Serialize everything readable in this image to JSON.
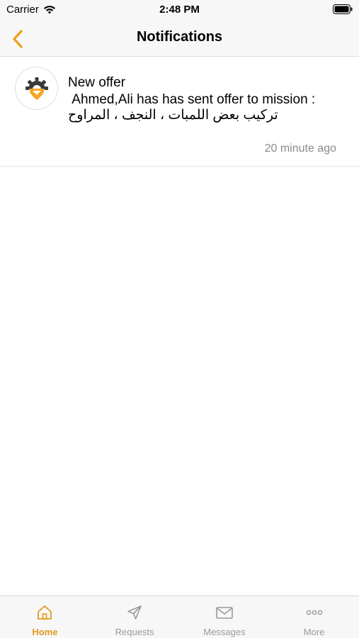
{
  "status_bar": {
    "carrier": "Carrier",
    "time": "2:48 PM"
  },
  "nav": {
    "title": "Notifications",
    "back_icon": "chevron-left-icon",
    "accent_color": "#f0a020"
  },
  "notifications": [
    {
      "title": "New offer",
      "body": " Ahmed,Ali has has sent offer to mission :",
      "mission": "تركيب بعض اللمبات ، النجف ، المراوح",
      "time": "20 minute ago",
      "avatar_icon": "gear-pin-logo-icon"
    }
  ],
  "tab_bar": {
    "active_color": "#e49a1c",
    "inactive_color": "#9a9a9a",
    "tabs": [
      {
        "label": "Home",
        "icon": "home-icon",
        "active": true
      },
      {
        "label": "Requests",
        "icon": "paper-plane-icon",
        "active": false
      },
      {
        "label": "Messages",
        "icon": "envelope-icon",
        "active": false
      },
      {
        "label": "More",
        "icon": "more-dots-icon",
        "active": false
      }
    ]
  }
}
